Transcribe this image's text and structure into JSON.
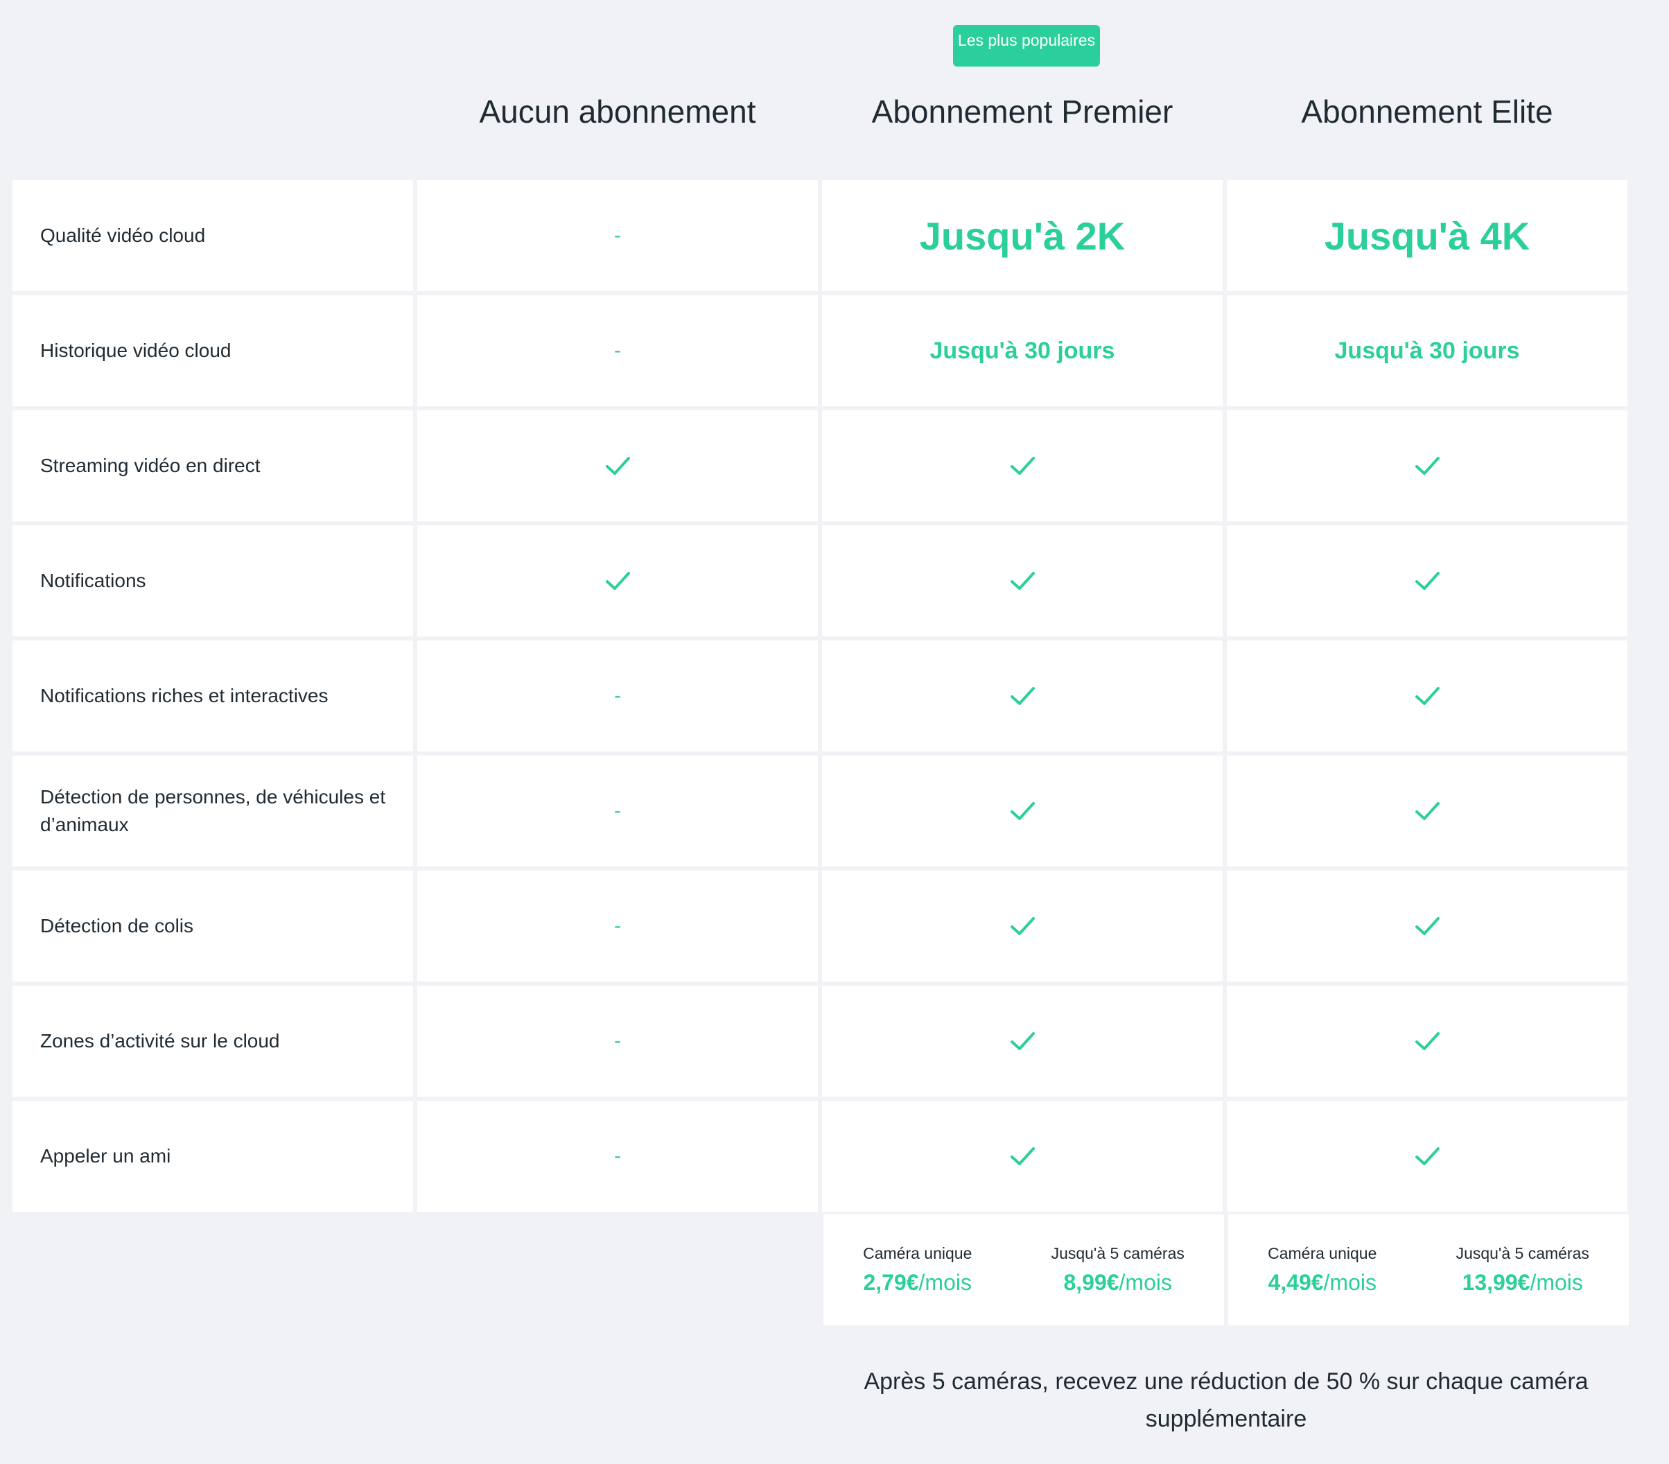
{
  "badge": "Les plus populaires",
  "columns": [
    "Aucun abonnement",
    "Abonnement Premier",
    "Abonnement Elite"
  ],
  "rows": [
    {
      "label": "Qualité vidéo cloud",
      "cells": [
        {
          "t": "dash",
          "v": "-"
        },
        {
          "t": "lg",
          "v": "Jusqu'à 2K"
        },
        {
          "t": "lg",
          "v": "Jusqu'à 4K"
        }
      ]
    },
    {
      "label": "Historique vidéo cloud",
      "cells": [
        {
          "t": "dash",
          "v": "-"
        },
        {
          "t": "md",
          "v": "Jusqu'à 30 jours"
        },
        {
          "t": "md",
          "v": "Jusqu'à 30 jours"
        }
      ]
    },
    {
      "label": "Streaming vidéo en direct",
      "cells": [
        {
          "t": "check"
        },
        {
          "t": "check"
        },
        {
          "t": "check"
        }
      ]
    },
    {
      "label": "Notifications",
      "cells": [
        {
          "t": "check"
        },
        {
          "t": "check"
        },
        {
          "t": "check"
        }
      ]
    },
    {
      "label": "Notifications riches et interactives",
      "cells": [
        {
          "t": "dash",
          "v": "-"
        },
        {
          "t": "check"
        },
        {
          "t": "check"
        }
      ]
    },
    {
      "label": "Détection de personnes, de véhicules et d’animaux",
      "cells": [
        {
          "t": "dash",
          "v": "-"
        },
        {
          "t": "check"
        },
        {
          "t": "check"
        }
      ]
    },
    {
      "label": "Détection de colis",
      "cells": [
        {
          "t": "dash",
          "v": "-"
        },
        {
          "t": "check"
        },
        {
          "t": "check"
        }
      ]
    },
    {
      "label": "Zones d’activité sur le cloud",
      "cells": [
        {
          "t": "dash",
          "v": "-"
        },
        {
          "t": "check"
        },
        {
          "t": "check"
        }
      ]
    },
    {
      "label": "Appeler un ami",
      "cells": [
        {
          "t": "dash",
          "v": "-"
        },
        {
          "t": "check"
        },
        {
          "t": "check"
        }
      ]
    }
  ],
  "pricing": [
    {
      "items": [
        {
          "caption": "Caméra unique",
          "amount": "2,79€",
          "unit": "/mois"
        },
        {
          "caption": "Jusqu'à 5 caméras",
          "amount": "8,99€",
          "unit": "/mois"
        }
      ]
    },
    {
      "items": [
        {
          "caption": "Caméra unique",
          "amount": "4,49€",
          "unit": "/mois"
        },
        {
          "caption": "Jusqu'à 5 caméras",
          "amount": "13,99€",
          "unit": "/mois"
        }
      ]
    }
  ],
  "note": "Après 5 caméras, recevez une réduction de 50 % sur chaque caméra supplémentaire",
  "colors": {
    "accent": "#2bcf9b",
    "background": "#f0f2f5",
    "card": "#ffffff",
    "text": "#1f2a33"
  },
  "icons": {
    "check": "check-icon"
  }
}
